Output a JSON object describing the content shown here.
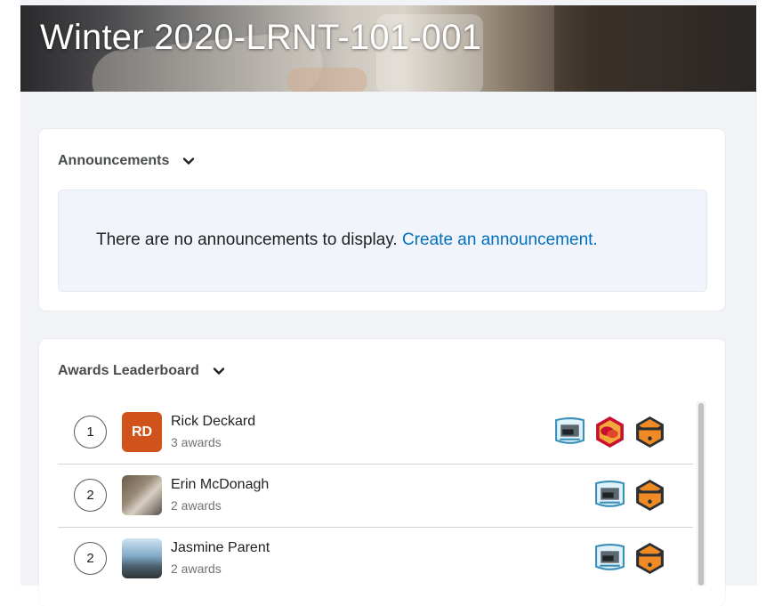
{
  "course": {
    "title": "Winter 2020-LRNT-101-001"
  },
  "announcements": {
    "header": "Announcements",
    "empty_message": "There are no announcements to display.",
    "create_link": "Create an announcement."
  },
  "awards": {
    "header": "Awards Leaderboard",
    "rows": [
      {
        "rank": "1",
        "initials": "RD",
        "name": "Rick Deckard",
        "count": "3 awards",
        "badges": [
          "screen-badge-icon",
          "chat-bubble-badge-icon",
          "hexagon-badge-icon"
        ]
      },
      {
        "rank": "2",
        "name": "Erin McDonagh",
        "count": "2 awards",
        "badges": [
          "screen-badge-icon",
          "hexagon-badge-icon"
        ]
      },
      {
        "rank": "2",
        "name": "Jasmine Parent",
        "count": "2 awards",
        "badges": [
          "screen-badge-icon",
          "hexagon-badge-icon"
        ]
      }
    ]
  },
  "colors": {
    "link": "#006fbf",
    "initials_avatar": "#d0531b",
    "notice_bg": "#f1f5fb"
  }
}
